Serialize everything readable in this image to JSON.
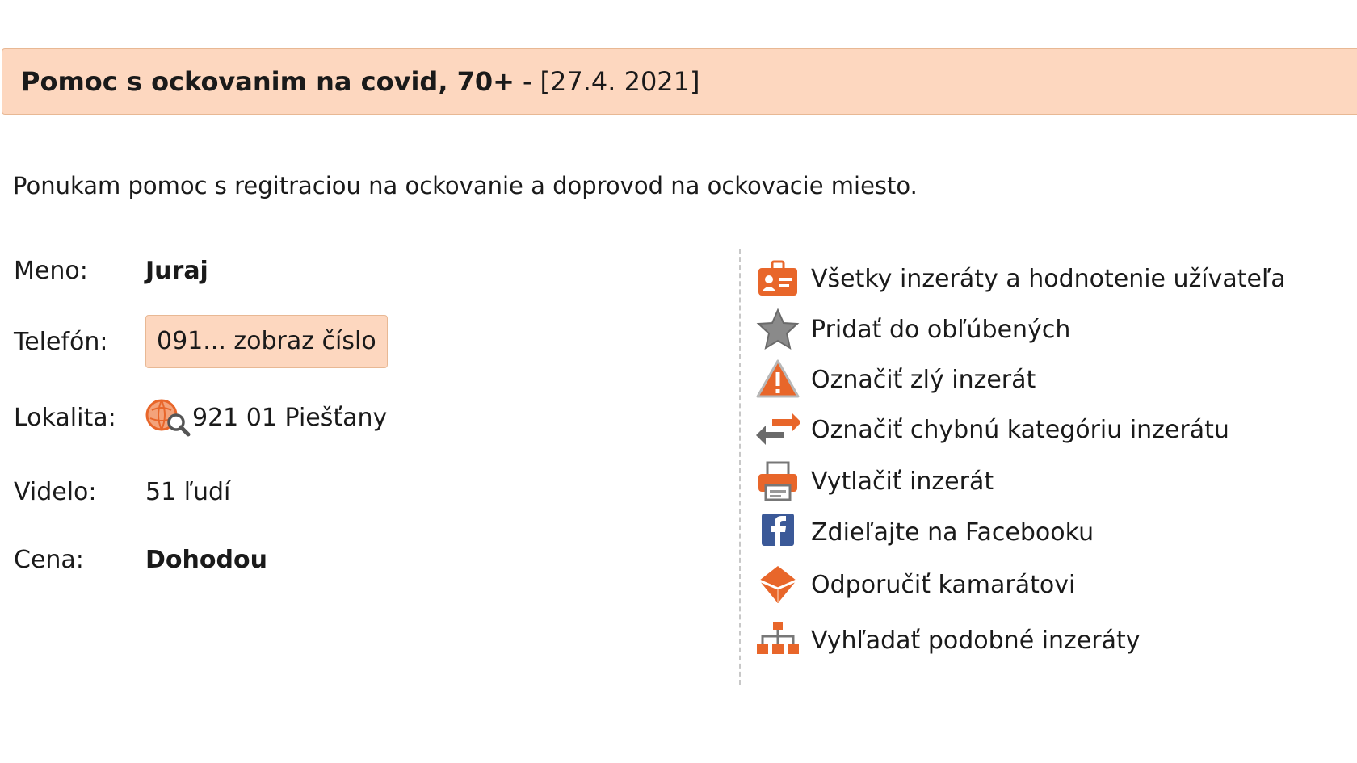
{
  "header": {
    "title": "Pomoc s ockovanim na covid, 70+",
    "separator": "-",
    "date": "[27.4. 2021]"
  },
  "description": "Ponukam pomoc s regitraciou na ockovanie a doprovod na ockovacie miesto.",
  "details": {
    "name_label": "Meno:",
    "name_value": "Juraj",
    "phone_label": "Telefón:",
    "phone_button": "091... zobraz číslo",
    "location_label": "Lokalita:",
    "location_value": "921 01 Piešťany",
    "views_label": "Videlo:",
    "views_value": "51 ľudí",
    "price_label": "Cena:",
    "price_value": "Dohodou"
  },
  "actions": [
    {
      "label": "Všetky inzeráty a hodnotenie užívateľa",
      "icon": "user-card-icon"
    },
    {
      "label": "Pridať do obľúbených",
      "icon": "star-icon"
    },
    {
      "label": "Označiť zlý inzerát",
      "icon": "warning-icon"
    },
    {
      "label": "Označiť chybnú kategóriu inzerátu",
      "icon": "swap-arrows-icon"
    },
    {
      "label": "Vytlačiť inzerát",
      "icon": "printer-icon"
    },
    {
      "label": "Zdieľajte na Facebooku",
      "icon": "facebook-icon"
    },
    {
      "label": "Odporučiť kamarátovi",
      "icon": "envelope-icon"
    },
    {
      "label": "Vyhľadať podobné inzeráty",
      "icon": "sitemap-icon"
    }
  ],
  "colors": {
    "header_bg": "#fdd7bf",
    "accent_orange": "#e8662a",
    "facebook_blue": "#3b5998"
  }
}
